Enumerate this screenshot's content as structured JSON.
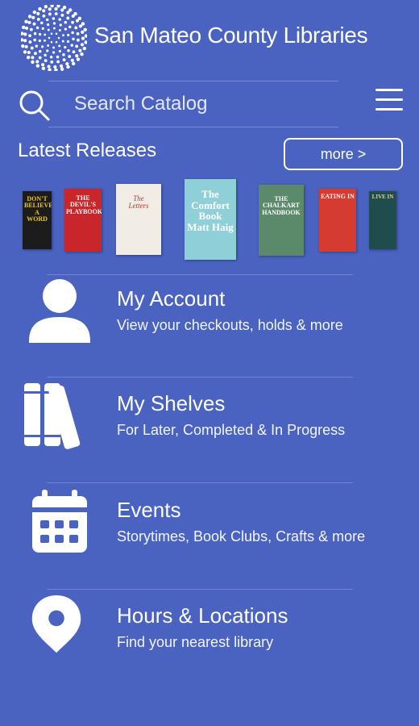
{
  "header": {
    "title": "San Mateo County Libraries",
    "logo_icon": "globe-dots-icon"
  },
  "search": {
    "placeholder": "Search Catalog",
    "value": ""
  },
  "latest": {
    "title": "Latest Releases",
    "more_label": "more >",
    "books": [
      {
        "lines": [
          "DON'T",
          "BELIEVE",
          "A WORD"
        ],
        "bg": "#1c1c1c",
        "fg": "#e8c52a"
      },
      {
        "lines": [
          "THE DEVIL'S",
          "PLAYBOOK"
        ],
        "bg": "#c8262a",
        "fg": "#ffffff"
      },
      {
        "lines": [
          "The",
          "Letters"
        ],
        "bg": "#f1ece4",
        "fg": "#b43a2e"
      },
      {
        "lines": [
          "The",
          "Comfort",
          "Book",
          "Matt Haig"
        ],
        "bg": "#8fd0d8",
        "fg": "#ffffff"
      },
      {
        "lines": [
          "THE",
          "CHALKART",
          "HANDBOOK"
        ],
        "bg": "#5b8a6a",
        "fg": "#ffffff"
      },
      {
        "lines": [
          "EATING IN"
        ],
        "bg": "#d63b2f",
        "fg": "#ffffff"
      },
      {
        "lines": [
          "LIVE IN"
        ],
        "bg": "#1f4d4d",
        "fg": "#f0d07a"
      }
    ]
  },
  "menu": [
    {
      "title": "My Account",
      "subtitle": "View your checkouts, holds & more",
      "icon": "person-icon"
    },
    {
      "title": "My Shelves",
      "subtitle": "For Later, Completed & In Progress",
      "icon": "books-icon"
    },
    {
      "title": "Events",
      "subtitle": "Storytimes, Book Clubs, Crafts & more",
      "icon": "calendar-icon"
    },
    {
      "title": "Hours & Locations",
      "subtitle": "Find your nearest library",
      "icon": "location-pin-icon"
    }
  ],
  "colors": {
    "background": "#4a62c0",
    "text": "#ffffff"
  }
}
